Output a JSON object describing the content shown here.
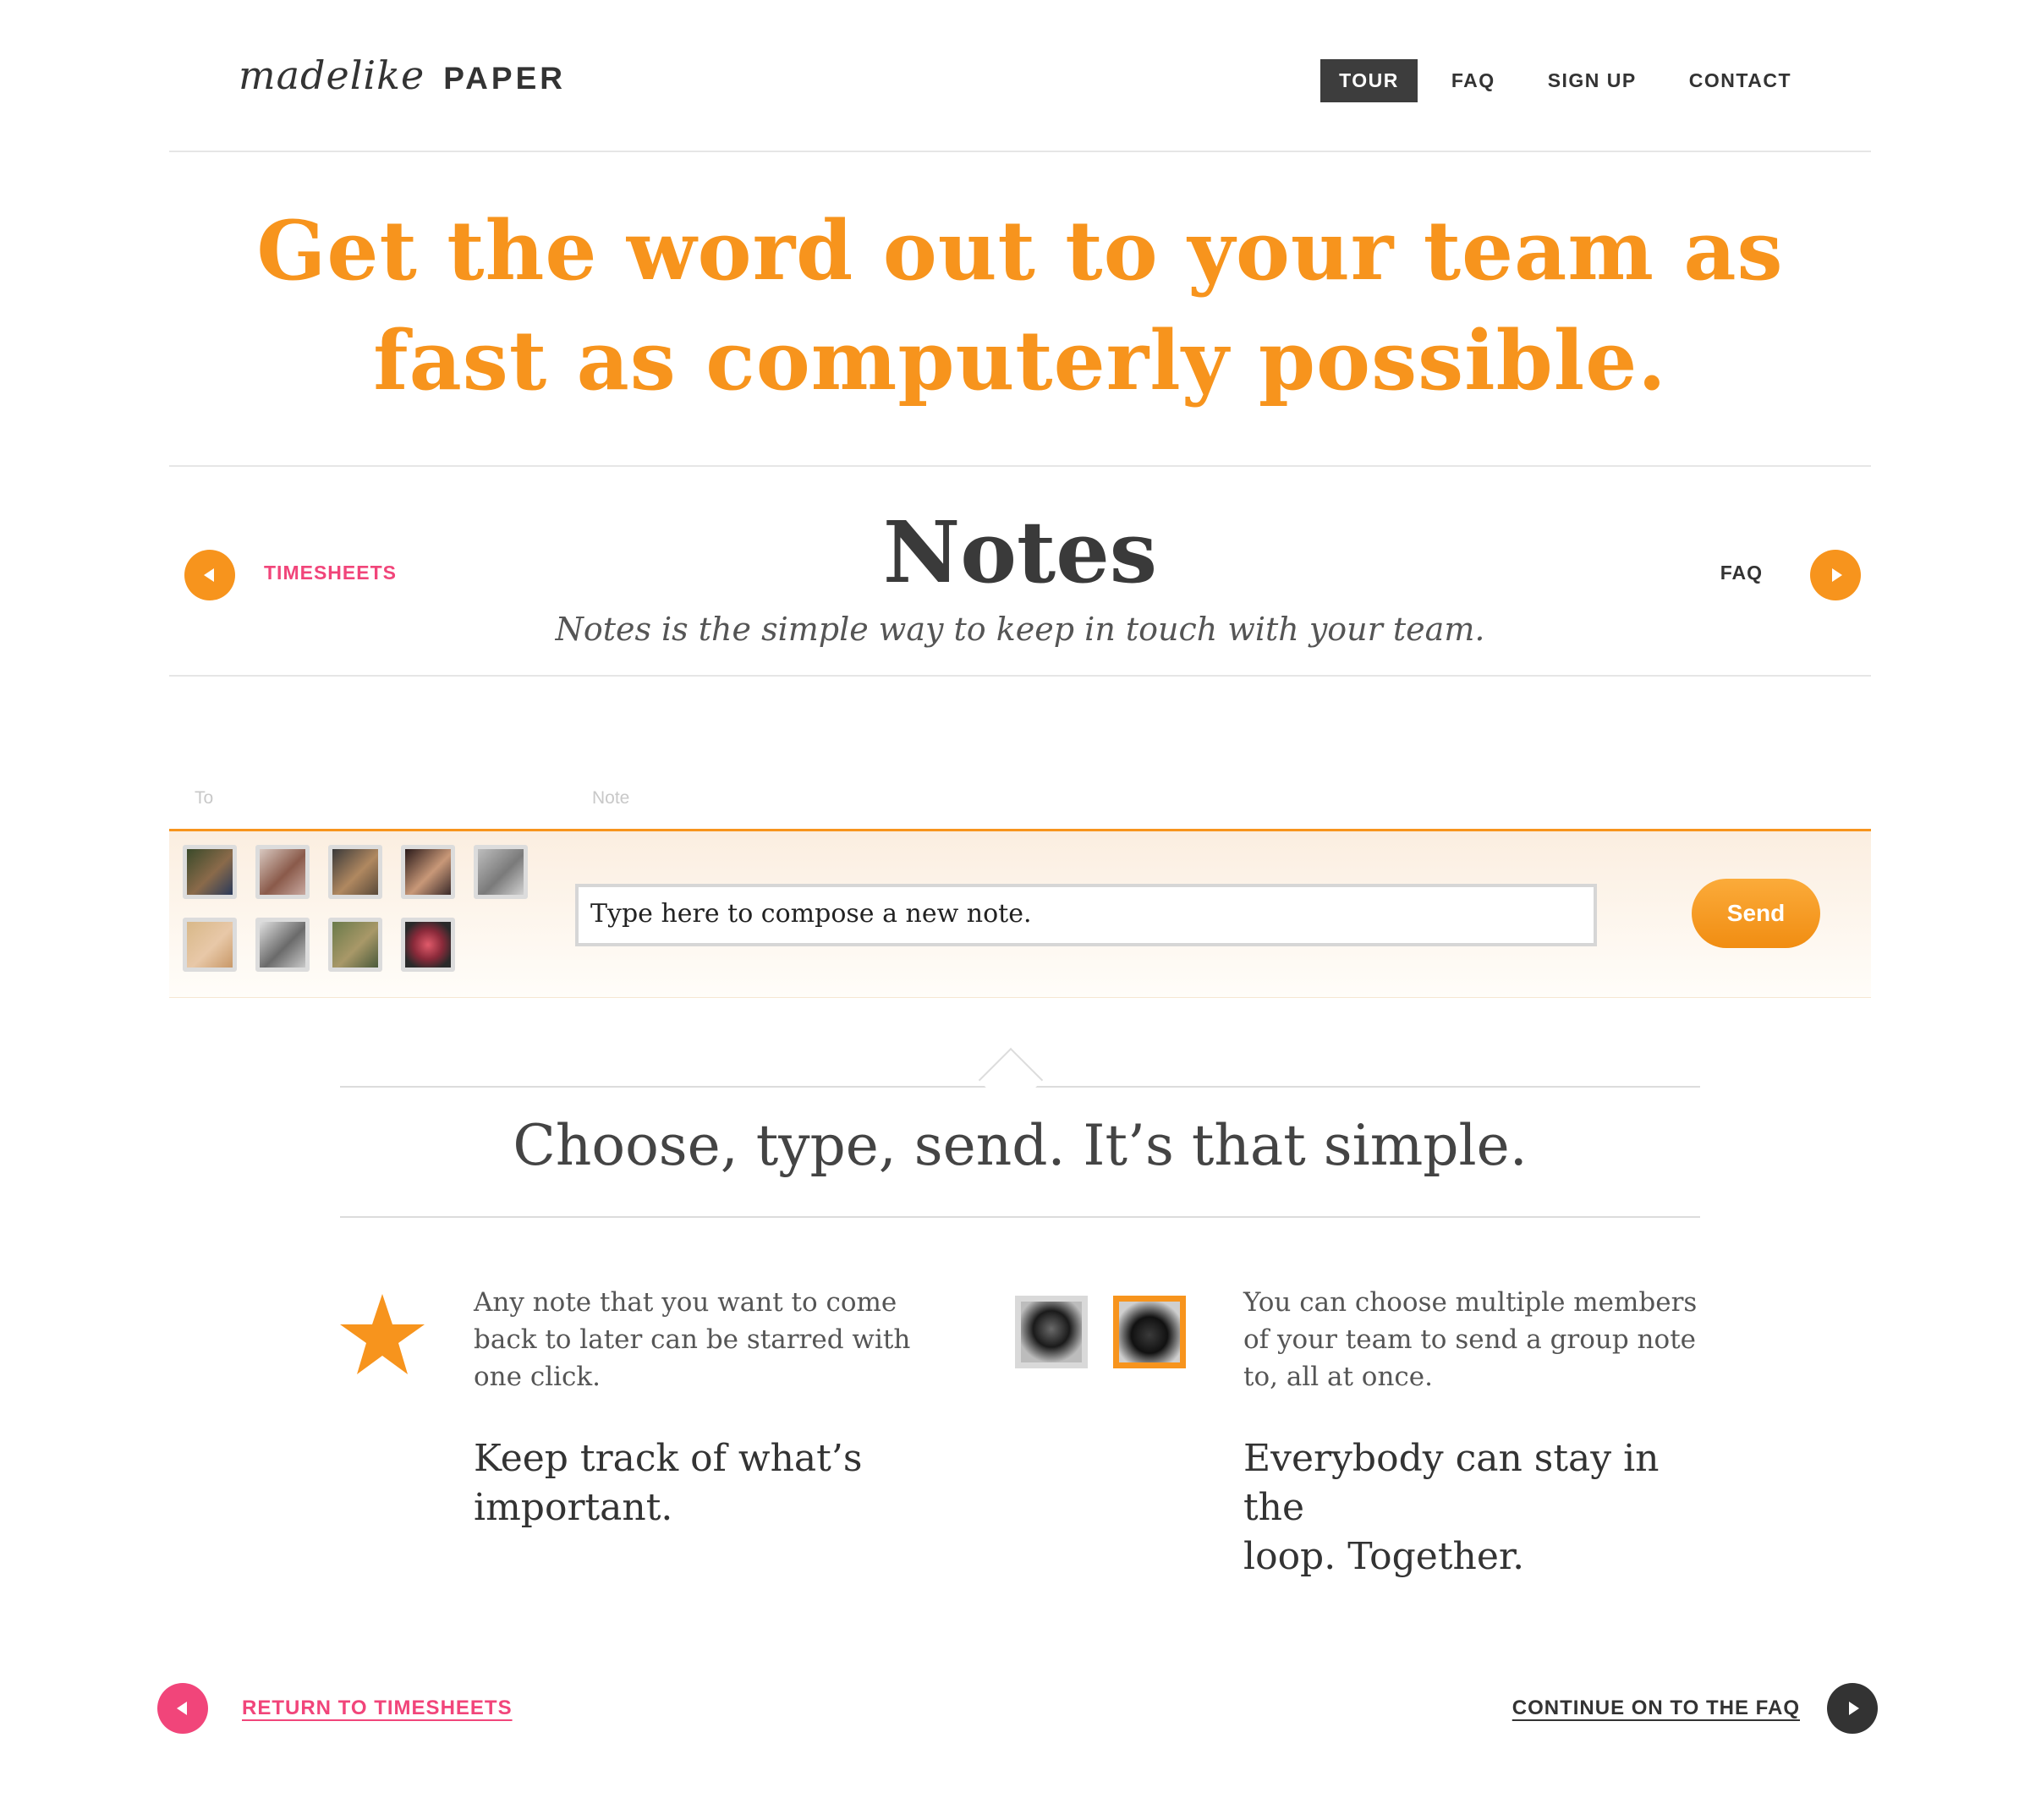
{
  "header": {
    "logo_script": "madelike",
    "logo_product": "PAPER",
    "nav": [
      {
        "label": "TOUR",
        "active": true
      },
      {
        "label": "FAQ",
        "active": false
      },
      {
        "label": "SIGN UP",
        "active": false
      },
      {
        "label": "CONTACT",
        "active": false
      }
    ]
  },
  "hero": {
    "line1": "Get the word out to your team as",
    "line2": "fast as computerly possible."
  },
  "section": {
    "prev_label": "TIMESHEETS",
    "next_label": "FAQ",
    "title": "Notes",
    "subtitle": "Notes is the simple way to keep in touch with your team."
  },
  "compose": {
    "to_label": "To",
    "note_label": "Note",
    "input_value": "Type here to compose a new note.",
    "send_label": "Send",
    "avatar_count": 9
  },
  "tagline": "Choose, type, send. It’s that simple.",
  "features": [
    {
      "icon": "star-icon",
      "text_lines": [
        "Any note that you want to come",
        "back to later can be starred with",
        "one click."
      ],
      "title_lines": [
        "Keep track of what’s",
        "important."
      ]
    },
    {
      "icon": "group-avatars",
      "text_lines": [
        "You can choose multiple members",
        "of your team to send a group note",
        "to, all at once."
      ],
      "title_lines": [
        "Everybody can stay in the",
        "loop. Together."
      ]
    }
  ],
  "footer": {
    "prev_label": "RETURN TO TIMESHEETS",
    "next_label": "CONTINUE ON TO THE FAQ"
  },
  "colors": {
    "accent_orange": "#f7941d",
    "accent_pink": "#f1457a",
    "dark": "#333333"
  }
}
